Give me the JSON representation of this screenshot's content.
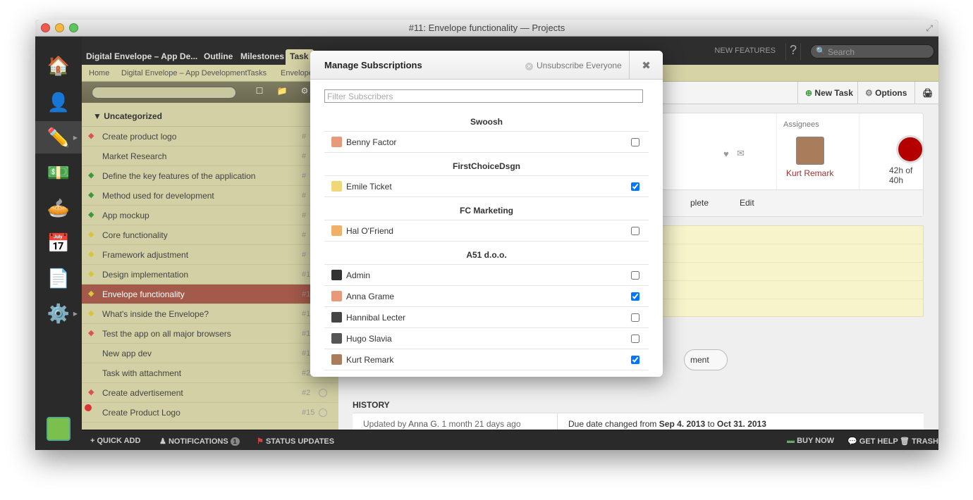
{
  "window": {
    "title": "#11: Envelope functionality — Projects"
  },
  "nav": {
    "tabs": [
      "Digital Envelope – App De...",
      "Outline",
      "Milestones",
      "Task"
    ],
    "new_features": "NEW FEATURES",
    "help": "?",
    "search_placeholder": "Search"
  },
  "breadcrumb": [
    "Home",
    "Digital Envelope – App Development",
    "Tasks",
    "Envelope"
  ],
  "tasks": {
    "group": "Uncategorized",
    "items": [
      {
        "name": "Create product logo",
        "num": "#",
        "tag": "#d9534f"
      },
      {
        "name": "Market Research",
        "num": "#",
        "tag": ""
      },
      {
        "name": "Define the key features of the application",
        "num": "#",
        "tag": "#3a9a3a"
      },
      {
        "name": "Method used for development",
        "num": "#",
        "tag": "#3a9a3a"
      },
      {
        "name": "App mockup",
        "num": "#",
        "tag": "#3a9a3a"
      },
      {
        "name": "Core functionality",
        "num": "#",
        "tag": "#d9c43a"
      },
      {
        "name": "Framework adjustment",
        "num": "#",
        "tag": "#d9c43a"
      },
      {
        "name": "Design implementation",
        "num": "#1",
        "tag": "#d9c43a"
      },
      {
        "name": "Envelope functionality",
        "num": "#1",
        "tag": "#d9c43a"
      },
      {
        "name": "What's inside the Envelope?",
        "num": "#1",
        "tag": "#d9c43a"
      },
      {
        "name": "Test the app on all major browsers",
        "num": "#1",
        "tag": "#d9534f"
      },
      {
        "name": "New app dev",
        "num": "#1",
        "tag": ""
      },
      {
        "name": "Task with attachment",
        "num": "#2",
        "tag": ""
      },
      {
        "name": "Create advertisement",
        "num": "#2",
        "tag": "#d9534f"
      },
      {
        "name": "Create Product Logo",
        "num": "#15",
        "tag": ""
      }
    ]
  },
  "main": {
    "new_task": "New Task",
    "options": "Options",
    "assignees_label": "Assignees",
    "assignee_name": "Kurt Remark",
    "time": "42h of 40h",
    "action_complete": "plete",
    "action_edit": "Edit",
    "comment_btn": "ment",
    "history_title": "HISTORY",
    "history_prefix": "Updated by",
    "history_user": "Anna G.",
    "history_when": "1 month 21 days ago",
    "history_change_pre": "Due date changed from",
    "history_from": "Sep 4. 2013",
    "history_to_word": "to",
    "history_to": "Oct 31. 2013"
  },
  "bottombar": {
    "quick_add": "QUICK ADD",
    "notifications": "NOTIFICATIONS",
    "notif_count": "1",
    "status_updates": "STATUS UPDATES",
    "buy_now": "BUY NOW",
    "get_help": "GET HELP",
    "trash": "TRASH"
  },
  "modal": {
    "title": "Manage Subscriptions",
    "unsubscribe_all": "Unsubscribe Everyone",
    "close": "✖",
    "filter_placeholder": "Filter Subscribers",
    "companies": [
      {
        "name": "Swoosh",
        "people": [
          {
            "name": "Benny Factor",
            "checked": false,
            "color": "#e79a7a"
          }
        ]
      },
      {
        "name": "FirstChoiceDsgn",
        "people": [
          {
            "name": "Emile Ticket",
            "checked": true,
            "color": "#f0d879"
          }
        ]
      },
      {
        "name": "FC Marketing",
        "people": [
          {
            "name": "Hal O'Friend",
            "checked": false,
            "color": "#f0b067"
          }
        ]
      },
      {
        "name": "A51 d.o.o.",
        "people": [
          {
            "name": "Admin",
            "checked": false,
            "color": "#333333"
          },
          {
            "name": "Anna Grame",
            "checked": true,
            "color": "#e79a7a"
          },
          {
            "name": "Hannibal Lecter",
            "checked": false,
            "color": "#444444"
          },
          {
            "name": "Hugo Slavia",
            "checked": false,
            "color": "#555555"
          },
          {
            "name": "Kurt Remark",
            "checked": true,
            "color": "#a97d5c"
          }
        ]
      }
    ]
  }
}
